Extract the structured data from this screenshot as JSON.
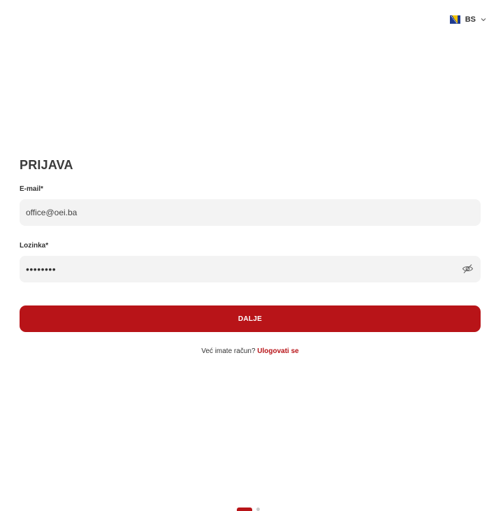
{
  "language": {
    "code": "BS",
    "flag_icon": "bosnia-flag-icon",
    "chevron_icon": "chevron-down-icon"
  },
  "form": {
    "title": "PRIJAVA",
    "email": {
      "label": "E-mail*",
      "value": "office@oei.ba"
    },
    "password": {
      "label": "Lozinka*",
      "value_masked": "••••••••",
      "toggle_icon": "eye-off-icon"
    },
    "submit_label": "DALJE",
    "helper_text": "Već imate račun?",
    "helper_link": "Ulogovati se"
  },
  "colors": {
    "accent": "#b81418",
    "field_bg": "#f3f3f3",
    "text": "#333333"
  }
}
